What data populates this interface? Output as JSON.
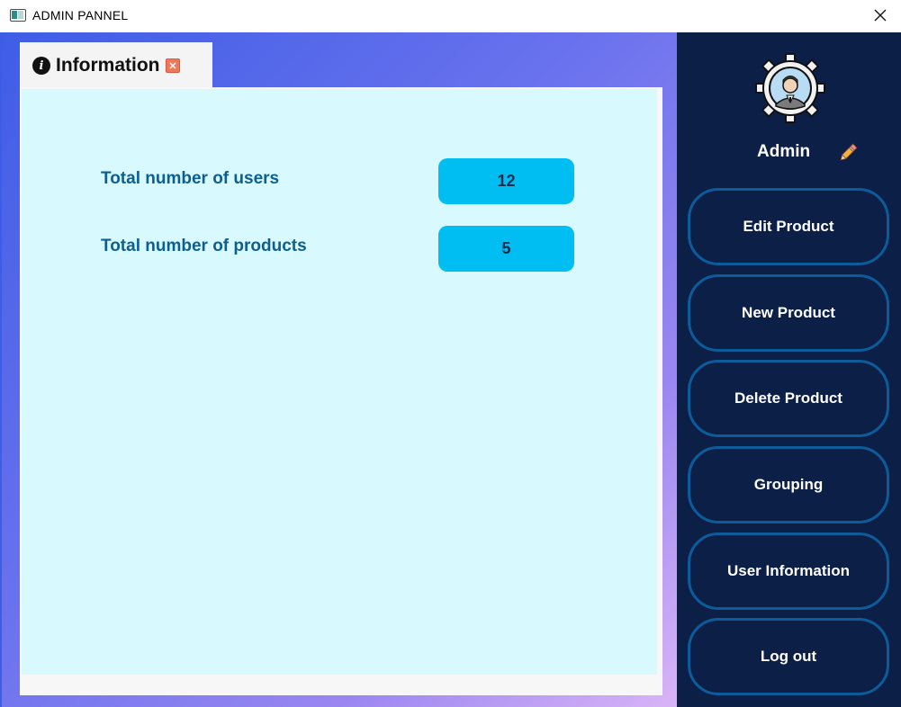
{
  "window": {
    "title": "ADMIN PANNEL"
  },
  "tab": {
    "label": "Information"
  },
  "stats": [
    {
      "label": "Total number of users",
      "value": "12"
    },
    {
      "label": "Total number of products",
      "value": "5"
    }
  ],
  "sidebar": {
    "admin_name": "Admin",
    "buttons": [
      {
        "label": "Edit Product"
      },
      {
        "label": "New Product"
      },
      {
        "label": "Delete Product"
      },
      {
        "label": "Grouping"
      },
      {
        "label": "User Information"
      },
      {
        "label": "Log out"
      }
    ]
  },
  "colors": {
    "sidebar_bg": "#0b1f47",
    "button_border": "#0c5c9c",
    "panel_bg": "#d8f9fd",
    "value_box": "#00bdf2",
    "label_text": "#0d5f92"
  },
  "icons": {
    "window": "app-window-icon",
    "close": "close-icon",
    "info": "info-icon",
    "tab_close": "tab-close-icon",
    "avatar": "admin-avatar-gear-icon",
    "edit": "pencil-icon"
  }
}
